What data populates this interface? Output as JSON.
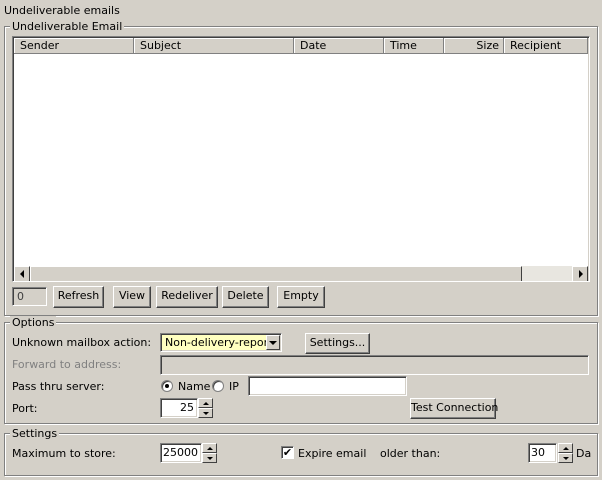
{
  "window_title": "Undeliverable emails",
  "undeliverable_group": {
    "title": "Undeliverable Email",
    "columns": [
      "Sender",
      "Subject",
      "Date",
      "Time",
      "Size",
      "Recipient"
    ],
    "rows": [],
    "count_value": "0",
    "buttons": {
      "refresh": "Refresh",
      "view": "View",
      "redeliver": "Redeliver",
      "delete": "Delete",
      "empty": "Empty"
    }
  },
  "options_group": {
    "title": "Options",
    "unknown_mailbox_label": "Unknown mailbox action:",
    "unknown_mailbox_value": "Non-delivery-report",
    "settings_button": "Settings...",
    "forward_label": "Forward to address:",
    "forward_value": "",
    "pass_thru_label": "Pass thru server:",
    "radio_name_label": "Name",
    "radio_ip_label": "IP",
    "radio_selected": "Name",
    "pass_thru_value": "",
    "port_label": "Port:",
    "port_value": "25",
    "test_connection_button": "Test Connection"
  },
  "settings_group": {
    "title": "Settings",
    "max_store_label": "Maximum to store:",
    "max_store_value": "25000",
    "expire_checked": true,
    "expire_label": "Expire email",
    "older_than_label": "older than:",
    "older_than_value": "30",
    "older_than_unit": "Da"
  },
  "colors": {
    "face": "#d4d0c8",
    "dropdown_bg": "#ffffc0",
    "disabled_text": "#808080"
  }
}
